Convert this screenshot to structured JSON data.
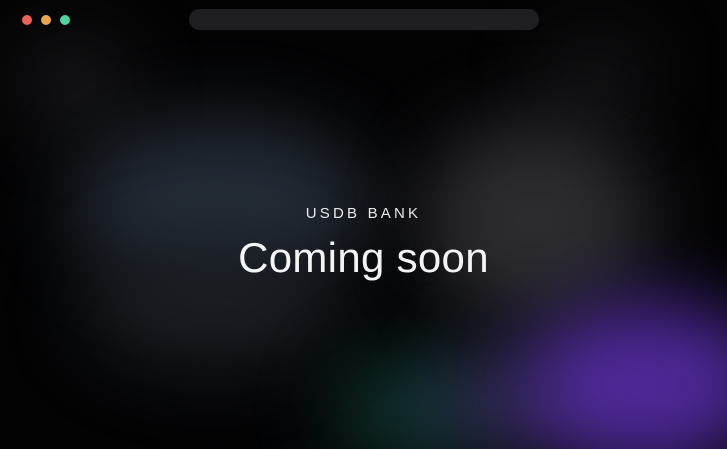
{
  "window": {
    "controls": {
      "close": {
        "icon": "close-dot-icon",
        "color": "#ec6459"
      },
      "minimize": {
        "icon": "minimize-dot-icon",
        "color": "#e6a653"
      },
      "maximize": {
        "icon": "maximize-dot-icon",
        "color": "#4fd3a0"
      }
    },
    "address_bar": {
      "value": ""
    }
  },
  "hero": {
    "eyebrow": "USDB BANK",
    "headline": "Coming soon"
  },
  "theme": {
    "background": "#030304",
    "accent_purple": "#5a2fb0",
    "accent_teal": "#123a35"
  }
}
